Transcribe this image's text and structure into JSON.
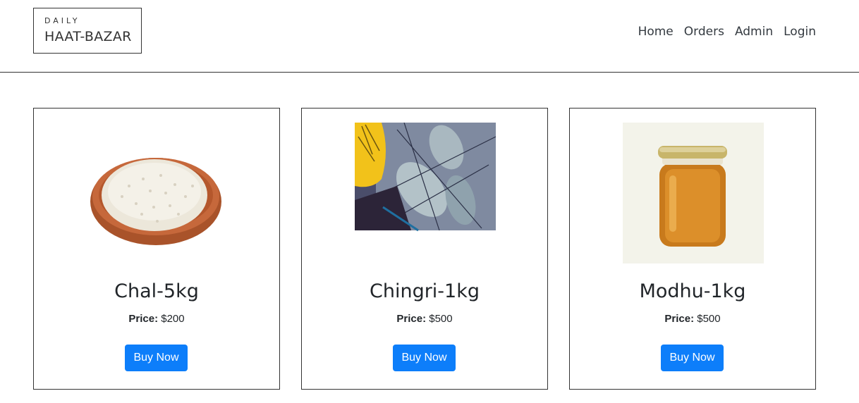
{
  "logo": {
    "small": "DAILY",
    "big": "HAAT-BAZAR"
  },
  "nav": [
    "Home",
    "Orders",
    "Admin",
    "Login"
  ],
  "products": [
    {
      "name": "Chal-5kg",
      "price_label": "Price:",
      "price": "$200",
      "button": "Buy Now",
      "image": "rice-bowl"
    },
    {
      "name": "Chingri-1kg",
      "price_label": "Price:",
      "price": "$500",
      "button": "Buy Now",
      "image": "prawns"
    },
    {
      "name": "Modhu-1kg",
      "price_label": "Price:",
      "price": "$500",
      "button": "Buy Now",
      "image": "honey-jar"
    }
  ],
  "colors": {
    "button": "#0d7efa",
    "text": "#212529",
    "border": "#333333"
  }
}
